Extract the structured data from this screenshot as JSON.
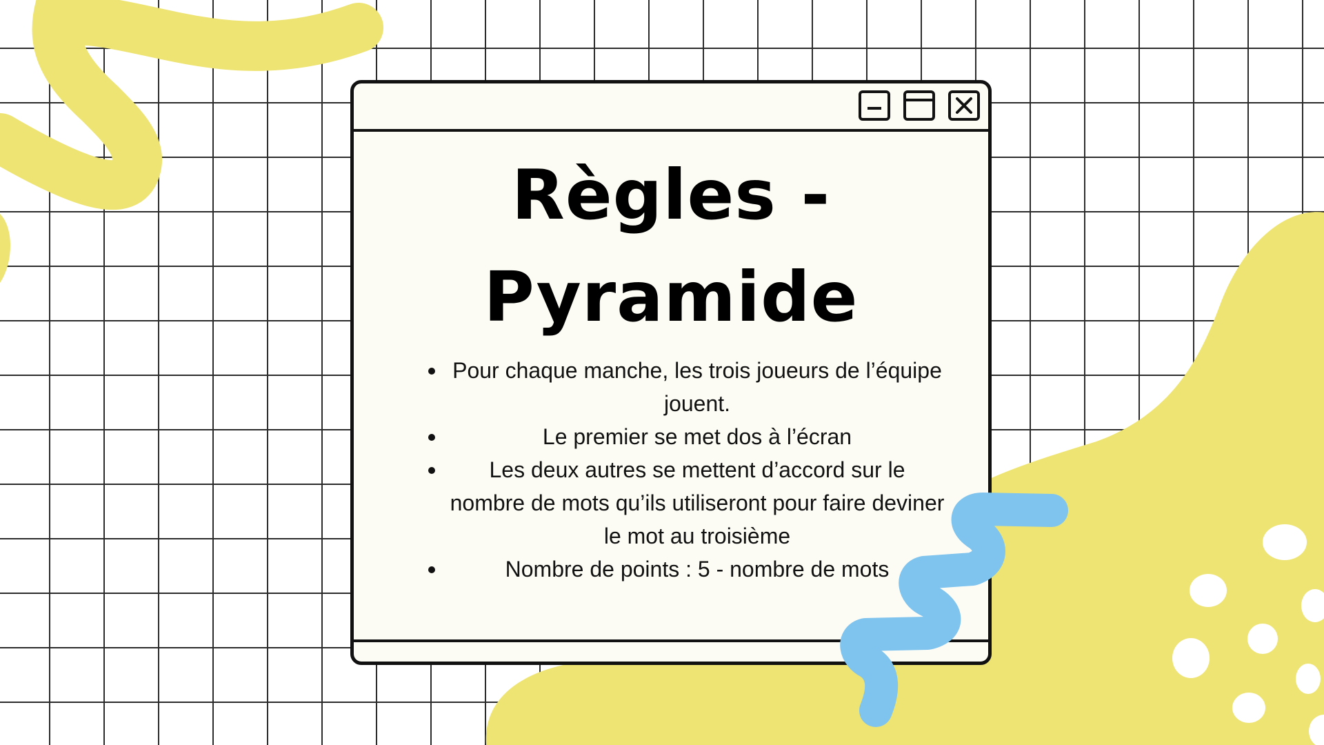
{
  "colors": {
    "background": "#ffffff",
    "grid": "#2b2b2b",
    "window_fill": "#fcfcf4",
    "window_border": "#111111",
    "yellow_accent": "#eee473",
    "blue_accent": "#7fc3ef",
    "dots": "#ffffff"
  },
  "window": {
    "controls": {
      "minimize_icon": "minimize-icon",
      "maximize_icon": "maximize-icon",
      "close_icon": "close-icon"
    },
    "title": "Règles - Pyramide",
    "rules": [
      "Pour chaque manche, les trois joueurs de l’équipe jouent.",
      "Le premier se met dos à l’écran",
      "Les deux autres se mettent d’accord sur le nombre de mots qu’ils utiliseront pour faire deviner le mot au troisième",
      "Nombre de points : 5 - nombre de mots"
    ]
  }
}
